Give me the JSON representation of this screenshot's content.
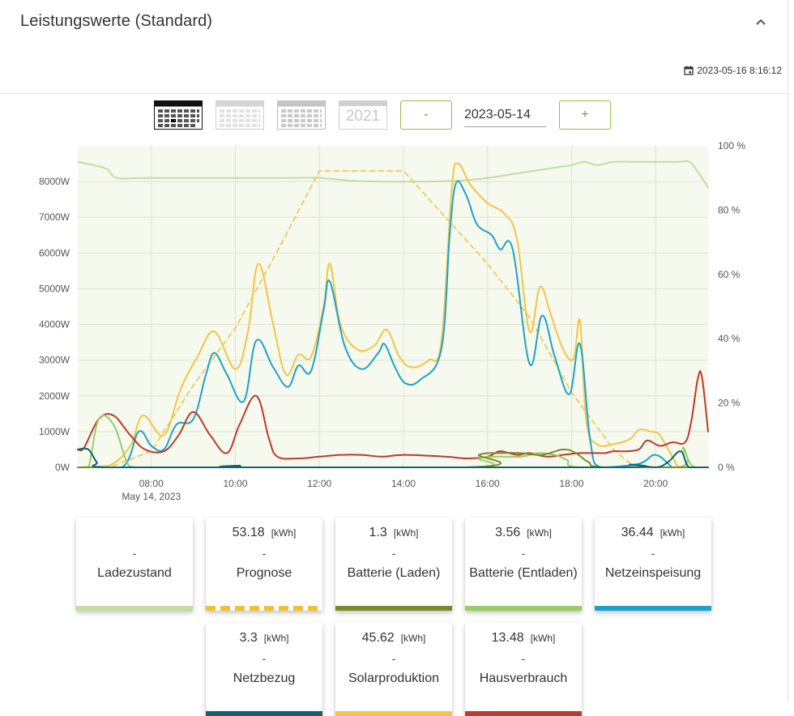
{
  "header": {
    "title": "Leistungswerte (Standard)",
    "timestamp": "2023-05-16 8:16:12"
  },
  "toolbar": {
    "year_label": "2021",
    "minus_label": "-",
    "plus_label": "+",
    "date_value": "2023-05-14"
  },
  "colors": {
    "ladezustand": "#c5dca0",
    "prognose": "#f2c037",
    "batterie_laden": "#7a8a2a",
    "batterie_entladen": "#9ccc65",
    "netzeinspeisung": "#1ea3c8",
    "netzbezug": "#0e6370",
    "solarproduktion": "#f6c445",
    "hausverbrauch": "#c0392b"
  },
  "chart_data": {
    "type": "line",
    "x_ticks": [
      "08:00",
      "10:00",
      "12:00",
      "14:00",
      "16:00",
      "18:00",
      "20:00"
    ],
    "x_sublabel": "May 14, 2023",
    "y_left_ticks": [
      "0W",
      "1000W",
      "2000W",
      "3000W",
      "4000W",
      "5000W",
      "6000W",
      "7000W",
      "8000W"
    ],
    "y_right_ticks": [
      "0 %",
      "20 %",
      "40 %",
      "60 %",
      "80 %",
      "100 %"
    ],
    "ylim_left": [
      0,
      9000
    ],
    "ylim_right": [
      0,
      100
    ],
    "xlim_hours": [
      6.25,
      21.25
    ],
    "series": [
      {
        "name": "Ladezustand",
        "key": "ladezustand",
        "axis": "right",
        "points": [
          [
            6.25,
            95
          ],
          [
            6.9,
            93
          ],
          [
            7.2,
            90
          ],
          [
            8,
            90
          ],
          [
            11,
            90
          ],
          [
            12,
            90
          ],
          [
            13,
            89
          ],
          [
            15,
            89
          ],
          [
            16,
            90
          ],
          [
            16.5,
            91
          ],
          [
            17,
            92
          ],
          [
            17.5,
            93
          ],
          [
            18,
            94
          ],
          [
            18.3,
            95
          ],
          [
            18.6,
            94
          ],
          [
            19,
            95
          ],
          [
            19.5,
            95
          ],
          [
            20.5,
            95
          ],
          [
            20.8,
            95
          ],
          [
            21,
            92
          ],
          [
            21.25,
            87
          ]
        ]
      },
      {
        "name": "Prognose",
        "key": "prognose",
        "axis": "left",
        "dashed": true,
        "points": [
          [
            6.25,
            0
          ],
          [
            7,
            0
          ],
          [
            8,
            450
          ],
          [
            9,
            2300
          ],
          [
            10,
            3900
          ],
          [
            11,
            6050
          ],
          [
            12,
            8300
          ],
          [
            13,
            8300
          ],
          [
            14,
            8300
          ],
          [
            15,
            7000
          ],
          [
            16,
            5700
          ],
          [
            17,
            4200
          ],
          [
            18,
            2100
          ],
          [
            19,
            500
          ],
          [
            19.5,
            0
          ],
          [
            21.25,
            0
          ]
        ]
      },
      {
        "name": "Solarproduktion",
        "key": "solarproduktion",
        "axis": "left",
        "points": [
          [
            6.25,
            0
          ],
          [
            7,
            50
          ],
          [
            7.5,
            600
          ],
          [
            7.8,
            1450
          ],
          [
            8.3,
            900
          ],
          [
            8.7,
            2200
          ],
          [
            9.1,
            3100
          ],
          [
            9.5,
            3800
          ],
          [
            10,
            2750
          ],
          [
            10.3,
            3800
          ],
          [
            10.55,
            5700
          ],
          [
            10.9,
            4000
          ],
          [
            11.2,
            2600
          ],
          [
            11.5,
            3150
          ],
          [
            11.8,
            3100
          ],
          [
            12.1,
            4500
          ],
          [
            12.25,
            5700
          ],
          [
            12.5,
            4000
          ],
          [
            12.9,
            3300
          ],
          [
            13.3,
            3400
          ],
          [
            13.6,
            3850
          ],
          [
            13.9,
            3100
          ],
          [
            14.2,
            2800
          ],
          [
            14.6,
            3000
          ],
          [
            14.9,
            3500
          ],
          [
            15.15,
            7800
          ],
          [
            15.3,
            8500
          ],
          [
            15.6,
            7900
          ],
          [
            16,
            7400
          ],
          [
            16.4,
            7100
          ],
          [
            16.7,
            6400
          ],
          [
            17,
            3800
          ],
          [
            17.25,
            5050
          ],
          [
            17.5,
            4300
          ],
          [
            17.8,
            3300
          ],
          [
            18.05,
            3050
          ],
          [
            18.2,
            4100
          ],
          [
            18.35,
            1300
          ],
          [
            18.6,
            650
          ],
          [
            19,
            650
          ],
          [
            19.4,
            800
          ],
          [
            19.6,
            1050
          ],
          [
            19.9,
            1000
          ],
          [
            20.1,
            900
          ],
          [
            20.4,
            300
          ],
          [
            20.6,
            0
          ],
          [
            21.25,
            0
          ]
        ]
      },
      {
        "name": "Netzeinspeisung",
        "key": "netzeinspeisung",
        "axis": "left",
        "points": [
          [
            6.25,
            0
          ],
          [
            7.3,
            0
          ],
          [
            7.7,
            1000
          ],
          [
            8,
            600
          ],
          [
            8.3,
            500
          ],
          [
            8.6,
            1200
          ],
          [
            9,
            1350
          ],
          [
            9.3,
            2600
          ],
          [
            9.5,
            3200
          ],
          [
            9.8,
            2600
          ],
          [
            10.2,
            1850
          ],
          [
            10.5,
            3550
          ],
          [
            10.9,
            2800
          ],
          [
            11.25,
            2250
          ],
          [
            11.5,
            2850
          ],
          [
            11.8,
            2700
          ],
          [
            12.1,
            4400
          ],
          [
            12.25,
            5200
          ],
          [
            12.6,
            3400
          ],
          [
            13,
            2750
          ],
          [
            13.4,
            3200
          ],
          [
            13.55,
            3450
          ],
          [
            13.8,
            2800
          ],
          [
            14.05,
            2350
          ],
          [
            14.4,
            2450
          ],
          [
            14.9,
            3300
          ],
          [
            15.1,
            6500
          ],
          [
            15.25,
            7950
          ],
          [
            15.5,
            7600
          ],
          [
            15.75,
            6800
          ],
          [
            16.1,
            6500
          ],
          [
            16.3,
            6100
          ],
          [
            16.6,
            6100
          ],
          [
            17,
            2900
          ],
          [
            17.3,
            4250
          ],
          [
            17.6,
            3100
          ],
          [
            17.95,
            2050
          ],
          [
            18.2,
            3450
          ],
          [
            18.45,
            700
          ],
          [
            18.7,
            0
          ],
          [
            19.6,
            100
          ],
          [
            20,
            350
          ],
          [
            20.4,
            0
          ],
          [
            20.5,
            0
          ],
          [
            20.85,
            0
          ],
          [
            21.25,
            0
          ]
        ]
      },
      {
        "name": "Hausverbrauch",
        "key": "hausverbrauch",
        "axis": "left",
        "points": [
          [
            6.25,
            500
          ],
          [
            6.4,
            550
          ],
          [
            6.75,
            1350
          ],
          [
            7.1,
            1450
          ],
          [
            7.5,
            900
          ],
          [
            7.85,
            500
          ],
          [
            8.3,
            450
          ],
          [
            8.65,
            900
          ],
          [
            9,
            1550
          ],
          [
            9.4,
            900
          ],
          [
            9.8,
            400
          ],
          [
            10.1,
            1200
          ],
          [
            10.5,
            2000
          ],
          [
            10.8,
            800
          ],
          [
            11,
            300
          ],
          [
            11.5,
            250
          ],
          [
            12,
            300
          ],
          [
            12.5,
            350
          ],
          [
            13,
            350
          ],
          [
            13.5,
            300
          ],
          [
            14,
            350
          ],
          [
            15,
            300
          ],
          [
            15.5,
            250
          ],
          [
            16,
            300
          ],
          [
            16.3,
            450
          ],
          [
            16.7,
            350
          ],
          [
            17,
            400
          ],
          [
            17.4,
            300
          ],
          [
            17.8,
            350
          ],
          [
            18.2,
            400
          ],
          [
            18.6,
            400
          ],
          [
            18.8,
            400
          ],
          [
            19,
            450
          ],
          [
            19.3,
            450
          ],
          [
            19.6,
            500
          ],
          [
            19.8,
            750
          ],
          [
            20.1,
            600
          ],
          [
            20.4,
            700
          ],
          [
            20.7,
            700
          ],
          [
            20.85,
            1300
          ],
          [
            21,
            2450
          ],
          [
            21.1,
            2550
          ],
          [
            21.25,
            1000
          ]
        ]
      },
      {
        "name": "Batterie (Entladen)",
        "key": "batterie_entladen",
        "axis": "left",
        "points": [
          [
            6.25,
            0
          ],
          [
            6.5,
            0
          ],
          [
            6.75,
            1350
          ],
          [
            7.1,
            1200
          ],
          [
            7.4,
            200
          ],
          [
            7.6,
            0
          ],
          [
            8.3,
            0
          ],
          [
            15.5,
            0
          ],
          [
            15.8,
            250
          ],
          [
            16.2,
            300
          ],
          [
            16.8,
            300
          ],
          [
            17.2,
            400
          ],
          [
            17.6,
            350
          ],
          [
            17.9,
            200
          ],
          [
            18.2,
            0
          ],
          [
            20.55,
            0
          ],
          [
            20.65,
            550
          ],
          [
            20.8,
            150
          ],
          [
            20.95,
            0
          ],
          [
            21.25,
            0
          ]
        ]
      },
      {
        "name": "Batterie (Laden)",
        "key": "batterie_laden",
        "axis": "left",
        "points": [
          [
            6.25,
            0
          ],
          [
            15.5,
            0
          ],
          [
            15.8,
            350
          ],
          [
            16.3,
            400
          ],
          [
            16.8,
            400
          ],
          [
            17.3,
            350
          ],
          [
            17.8,
            500
          ],
          [
            18.1,
            400
          ],
          [
            18.4,
            150
          ],
          [
            18.8,
            0
          ],
          [
            21.25,
            0
          ]
        ]
      },
      {
        "name": "Netzbezug",
        "key": "netzbezug",
        "axis": "left",
        "points": [
          [
            6.25,
            500
          ],
          [
            6.5,
            500
          ],
          [
            6.7,
            150
          ],
          [
            6.9,
            0
          ],
          [
            9.8,
            0
          ],
          [
            10.1,
            50
          ],
          [
            10.4,
            0
          ],
          [
            19,
            0
          ],
          [
            19.4,
            80
          ],
          [
            20,
            0
          ],
          [
            20.3,
            150
          ],
          [
            20.6,
            450
          ],
          [
            20.8,
            0
          ],
          [
            21.25,
            0
          ]
        ]
      }
    ]
  },
  "cards": [
    {
      "key": "ladezustand",
      "value": "",
      "unit": "",
      "dash": "-",
      "label": "Ladezustand"
    },
    {
      "key": "prognose",
      "value": "53.18",
      "unit": "[kWh]",
      "dash": "-",
      "label": "Prognose"
    },
    {
      "key": "batterie_laden",
      "value": "1.3",
      "unit": "[kWh]",
      "dash": "-",
      "label": "Batterie (Laden)"
    },
    {
      "key": "batterie_entladen",
      "value": "3.56",
      "unit": "[kWh]",
      "dash": "-",
      "label": "Batterie (Entladen)"
    },
    {
      "key": "netzeinspeisung",
      "value": "36.44",
      "unit": "[kWh]",
      "dash": "-",
      "label": "Netzeinspeisung"
    },
    {
      "key": "netzbezug",
      "value": "3.3",
      "unit": "[kWh]",
      "dash": "-",
      "label": "Netzbezug"
    },
    {
      "key": "solarproduktion",
      "value": "45.62",
      "unit": "[kWh]",
      "dash": "-",
      "label": "Solarproduktion"
    },
    {
      "key": "hausverbrauch",
      "value": "13.48",
      "unit": "[kWh]",
      "dash": "-",
      "label": "Hausverbrauch"
    }
  ]
}
